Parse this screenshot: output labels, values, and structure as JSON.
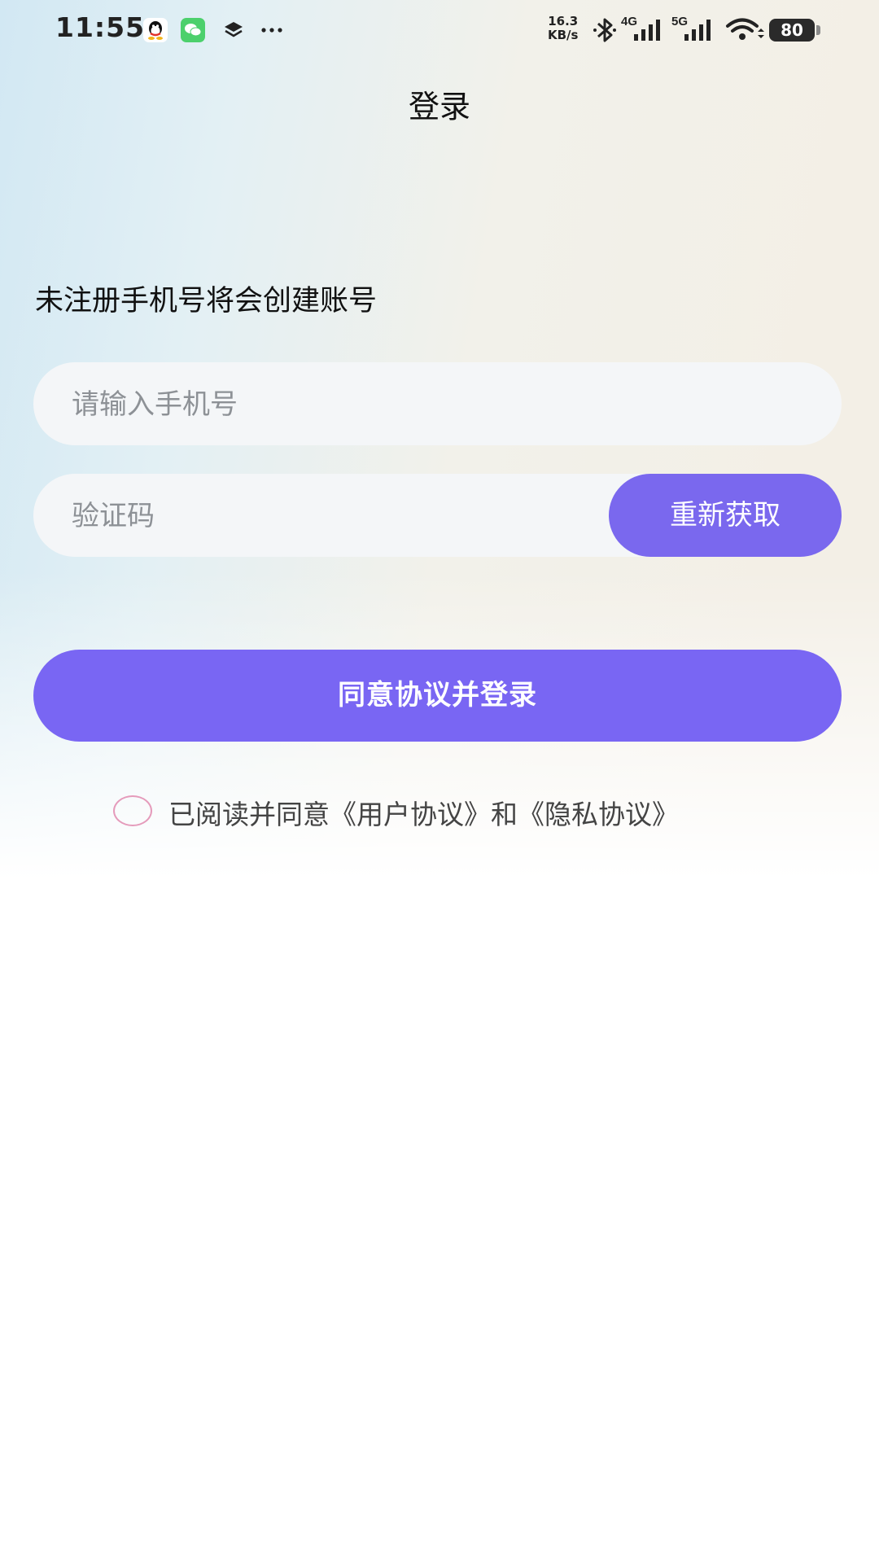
{
  "status_bar": {
    "time": "11:55",
    "net_speed_value": "16.3",
    "net_speed_unit": "KB/s",
    "signal_1_label": "4G",
    "signal_2_label": "5G",
    "battery": "80",
    "icons": [
      "qq-icon",
      "wechat-icon",
      "layers-icon",
      "more-icon",
      "bluetooth-icon",
      "signal-icon",
      "wifi-icon",
      "battery-icon"
    ]
  },
  "header": {
    "title": "登录"
  },
  "form": {
    "hint": "未注册手机号将会创建账号",
    "phone_placeholder": "请输入手机号",
    "phone_value": "",
    "code_placeholder": "验证码",
    "code_value": "",
    "resend_label": "重新获取",
    "login_label": "同意协议并登录"
  },
  "agreement": {
    "checked": false,
    "text": "已阅读并同意《用户协议》和《隐私协议》"
  },
  "colors": {
    "accent": "#7966f3",
    "radio_border": "#e59bbb",
    "field_bg": "#f4f6f8"
  }
}
